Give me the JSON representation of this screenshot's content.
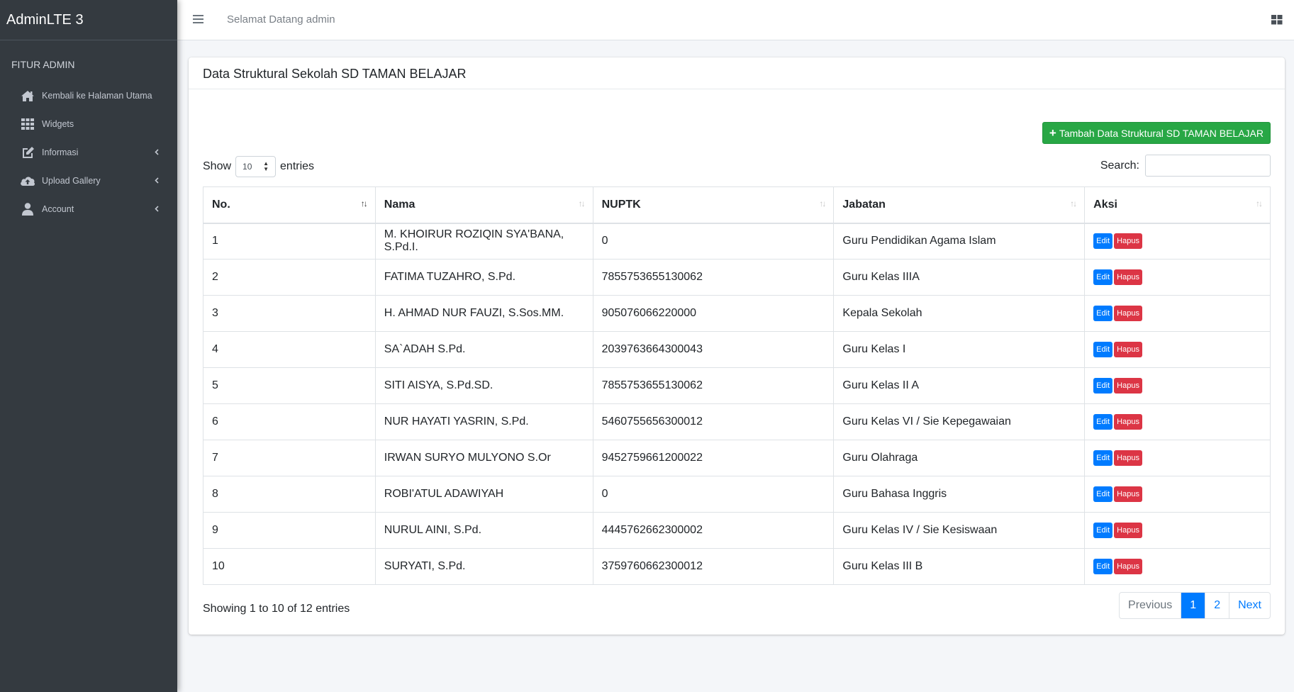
{
  "sidebar": {
    "brand": "AdminLTE 3",
    "header": "FITUR ADMIN",
    "items": [
      {
        "label": "Kembali ke Halaman Utama",
        "icon": "home-icon",
        "has_chevron": false
      },
      {
        "label": "Widgets",
        "icon": "th-grid-icon",
        "has_chevron": false
      },
      {
        "label": "Informasi",
        "icon": "edit-icon",
        "has_chevron": true
      },
      {
        "label": "Upload Gallery",
        "icon": "cloud-upload-icon",
        "has_chevron": true
      },
      {
        "label": "Account",
        "icon": "user-icon",
        "has_chevron": true
      }
    ]
  },
  "navbar": {
    "welcome": "Selamat Datang admin",
    "menu_icon": "bars-icon",
    "right_icon": "th-large-icon"
  },
  "card": {
    "title": "Data Struktural Sekolah SD TAMAN BELAJAR",
    "add_button": "Tambah Data Struktural SD TAMAN BELAJAR"
  },
  "table_controls": {
    "show_label": "Show",
    "entries_value": "10",
    "entries_label": "entries",
    "search_label": "Search:",
    "search_value": ""
  },
  "table": {
    "columns": [
      "No.",
      "Nama",
      "NUPTK",
      "Jabatan",
      "Aksi"
    ],
    "edit_label": "Edit",
    "delete_label": "Hapus",
    "rows": [
      {
        "no": "1",
        "nama": "M. KHOIRUR ROZIQIN SYA'BANA, S.Pd.I.",
        "nuptk": "0",
        "jabatan": "Guru Pendidikan Agama Islam"
      },
      {
        "no": "2",
        "nama": "FATIMA TUZAHRO, S.Pd.",
        "nuptk": "7855753655130062",
        "jabatan": "Guru Kelas IIIA"
      },
      {
        "no": "3",
        "nama": "H. AHMAD NUR FAUZI, S.Sos.MM.",
        "nuptk": "905076066220000",
        "jabatan": "Kepala Sekolah"
      },
      {
        "no": "4",
        "nama": "SA`ADAH S.Pd.",
        "nuptk": "2039763664300043",
        "jabatan": "Guru Kelas I"
      },
      {
        "no": "5",
        "nama": "SITI AISYA, S.Pd.SD.",
        "nuptk": "7855753655130062",
        "jabatan": "Guru Kelas II A"
      },
      {
        "no": "6",
        "nama": "NUR HAYATI YASRIN, S.Pd.",
        "nuptk": "5460755656300012",
        "jabatan": "Guru Kelas VI / Sie Kepegawaian"
      },
      {
        "no": "7",
        "nama": "IRWAN SURYO MULYONO S.Or",
        "nuptk": "9452759661200022",
        "jabatan": "Guru Olahraga"
      },
      {
        "no": "8",
        "nama": "ROBI'ATUL ADAWIYAH",
        "nuptk": "0",
        "jabatan": "Guru Bahasa Inggris"
      },
      {
        "no": "9",
        "nama": "NURUL AINI, S.Pd.",
        "nuptk": "4445762662300002",
        "jabatan": "Guru Kelas IV / Sie Kesiswaan"
      },
      {
        "no": "10",
        "nama": "SURYATI, S.Pd.",
        "nuptk": "3759760662300012",
        "jabatan": "Guru Kelas III B"
      }
    ]
  },
  "footer": {
    "info": "Showing 1 to 10 of 12 entries",
    "pagination": {
      "previous": "Previous",
      "pages": [
        "1",
        "2"
      ],
      "active_page": "1",
      "next": "Next"
    }
  },
  "colors": {
    "sidebar_bg": "#343a40",
    "primary": "#007bff",
    "success": "#28a745",
    "danger": "#dc3545"
  }
}
